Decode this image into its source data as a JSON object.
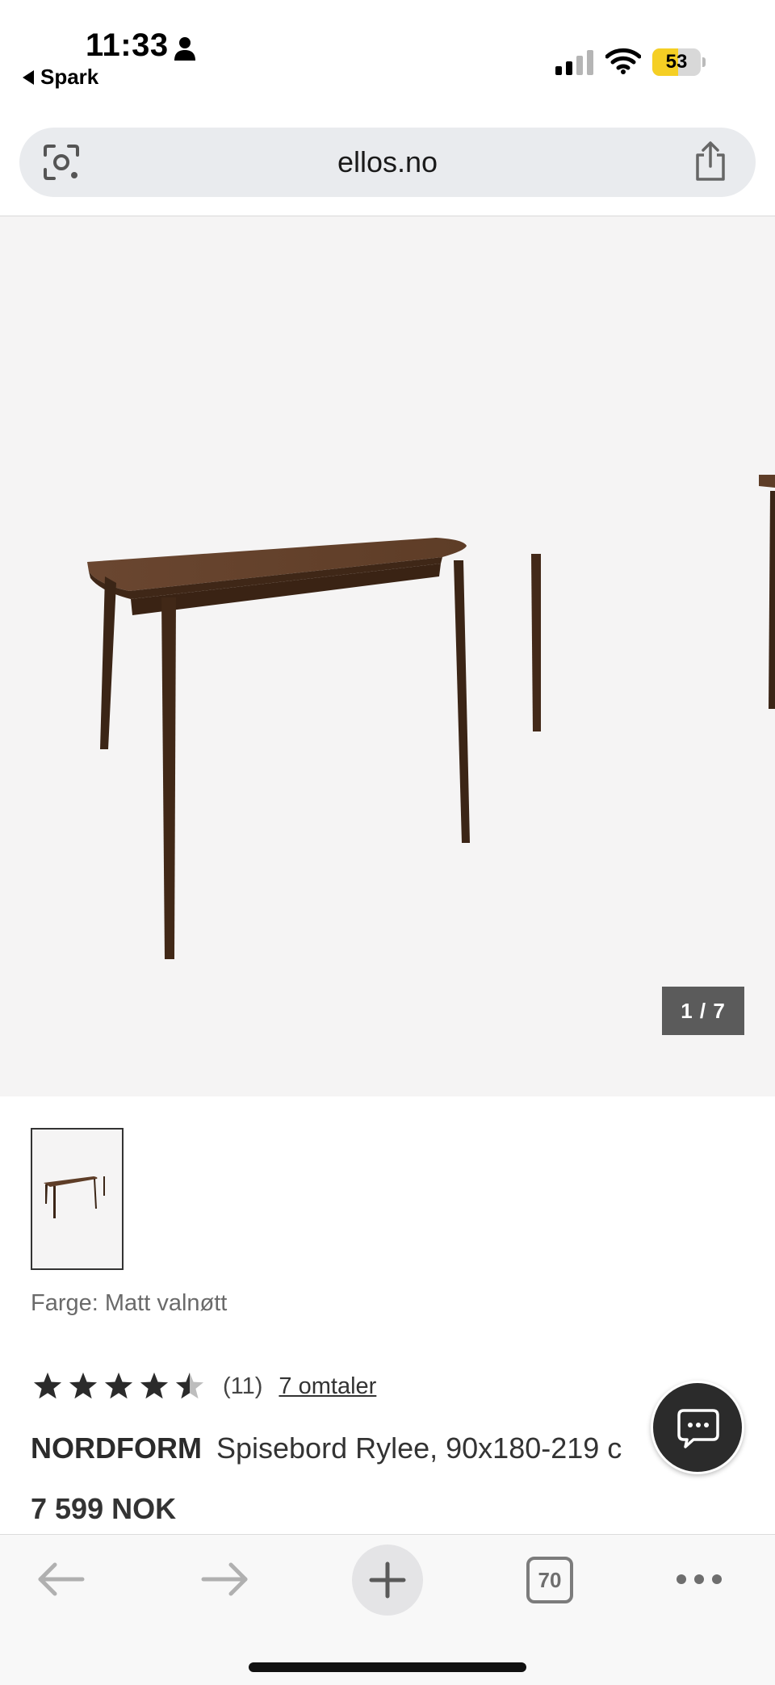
{
  "status_bar": {
    "time": "11:33",
    "back_app": "Spark",
    "battery_percent": 53,
    "icons": [
      "person-icon",
      "signal-icon",
      "wifi-icon",
      "battery-icon"
    ]
  },
  "browser": {
    "url": "ellos.no",
    "icons": [
      "camera-search-icon",
      "share-icon"
    ]
  },
  "gallery": {
    "counter": "1 / 7",
    "current": 1,
    "total": 7
  },
  "product": {
    "color_label": "Farge: Matt valnøtt",
    "rating": 4.5,
    "rating_max": 5,
    "rating_count": "(11)",
    "reviews_link": "7 omtaler",
    "brand": "NORDFORM",
    "title": "Spisebord Rylee, 90x180-219 c",
    "price": "7 599 NOK"
  },
  "toolbar": {
    "tab_count": "70",
    "icons": [
      "back-arrow-icon",
      "forward-arrow-icon",
      "new-tab-icon",
      "tabs-icon",
      "more-icon"
    ]
  },
  "colors": {
    "wood": "#5a3b25",
    "battery": "#f5cf24",
    "chat_bg": "#2b2b2b"
  }
}
